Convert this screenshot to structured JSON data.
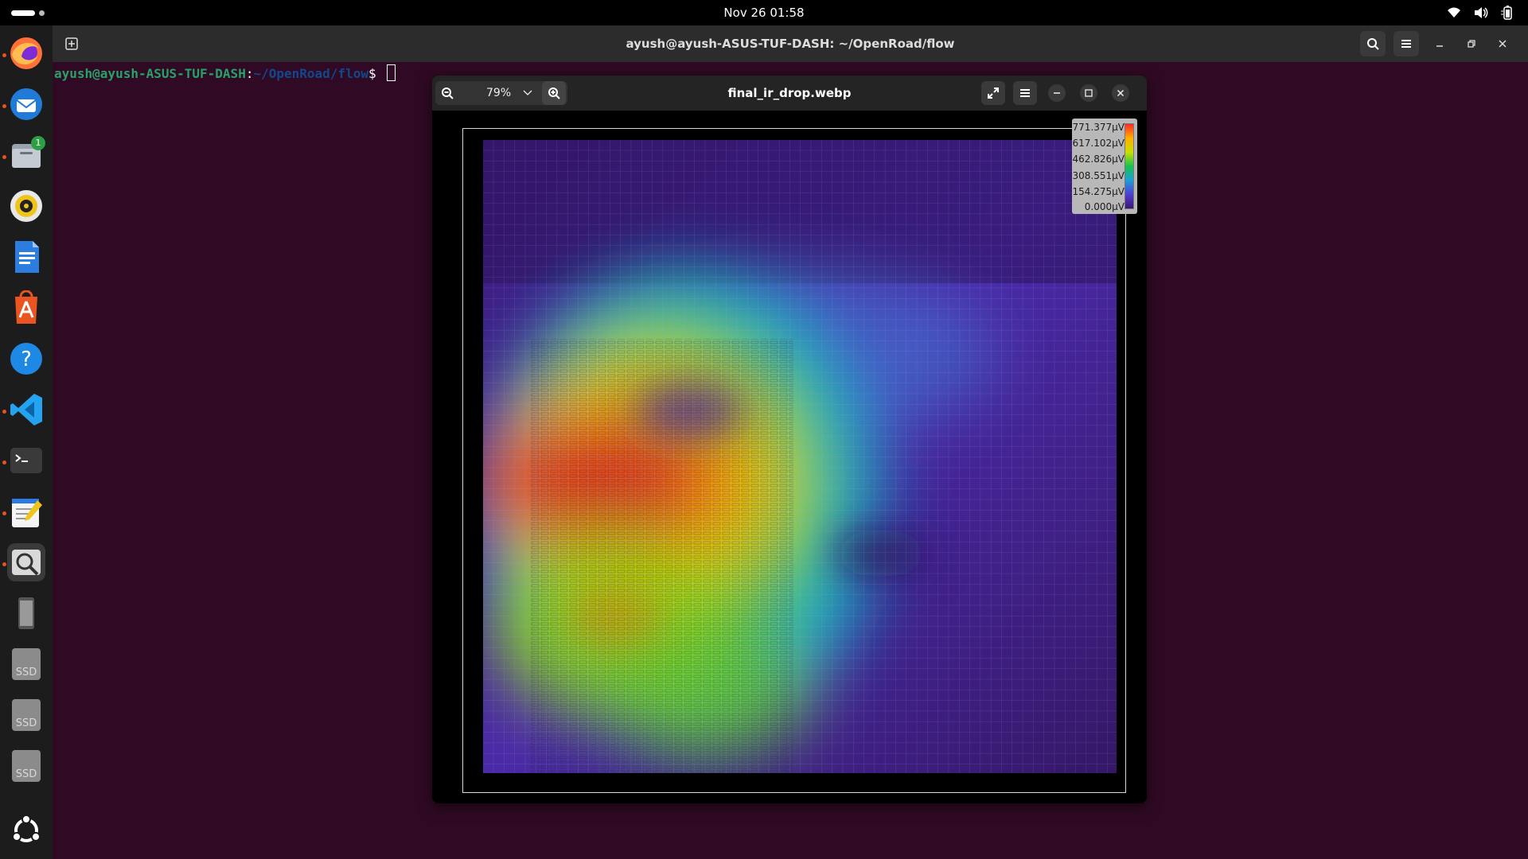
{
  "top_bar": {
    "clock": "Nov 26  01:58",
    "tray_icons": [
      "wifi-icon",
      "volume-icon",
      "battery-icon"
    ]
  },
  "dock": {
    "items": [
      {
        "name": "firefox",
        "running": true,
        "color": "#ff7139"
      },
      {
        "name": "thunderbird",
        "running": true,
        "color": "#1f7ad8"
      },
      {
        "name": "files",
        "running": true,
        "badge": "1",
        "color": "#9aa3ad"
      },
      {
        "name": "rhythmbox",
        "running": false,
        "color": "#f0c419"
      },
      {
        "name": "libreoffice-writer",
        "running": false,
        "color": "#2b7de0"
      },
      {
        "name": "app-center",
        "running": false,
        "color": "#e95420"
      },
      {
        "name": "help",
        "running": false,
        "color": "#1e88e5"
      },
      {
        "name": "vscode",
        "running": true,
        "color": "#23a3f0"
      },
      {
        "name": "terminal",
        "running": true,
        "color": "#3a3a3a"
      },
      {
        "name": "text-editor",
        "running": true,
        "color": "#2c7be5"
      },
      {
        "name": "image-viewer",
        "running": true,
        "color": "#d9d9d9"
      },
      {
        "name": "phone-device",
        "running": false,
        "color": "#666666"
      },
      {
        "name": "ssd-drive",
        "label": "SSD",
        "running": false
      },
      {
        "name": "ssd-drive",
        "label": "SSD",
        "running": false
      },
      {
        "name": "ssd-drive",
        "label": "SSD",
        "running": false
      },
      {
        "name": "show-apps",
        "running": false
      }
    ]
  },
  "terminal": {
    "title": "ayush@ayush-ASUS-TUF-DASH: ~/OpenRoad/flow",
    "prompt_user": "ayush@ayush-ASUS-TUF-DASH",
    "prompt_sep": ":",
    "prompt_path": "~/OpenRoad/flow",
    "prompt_symbol": "$ ",
    "colors": {
      "user": "#26a269",
      "path": "#12488b",
      "background": "#300a24"
    }
  },
  "viewer": {
    "title": "final_ir_drop.webp",
    "zoom": "79%",
    "legend": {
      "labels": [
        "771.377μV",
        "617.102μV",
        "462.826μV",
        "308.551μV",
        "154.275μV",
        "0.000μV"
      ],
      "colors": [
        "#ff2a2a",
        "#ffae00",
        "#c8e000",
        "#17c24f",
        "#1c9fd8",
        "#4f3ed3",
        "#3a1874"
      ]
    }
  }
}
